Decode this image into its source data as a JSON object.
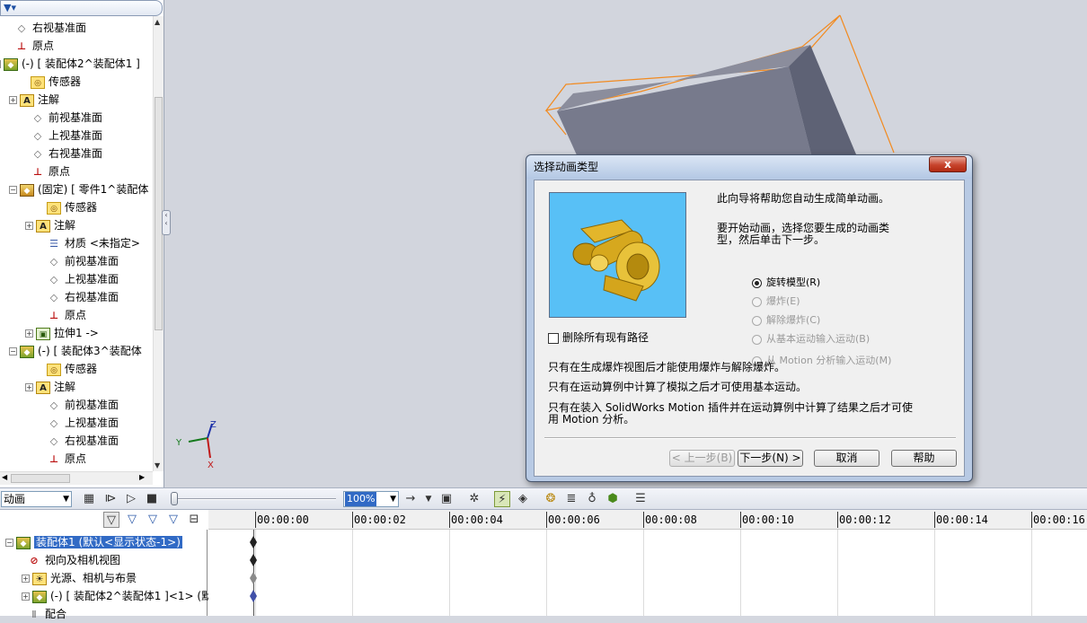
{
  "tree": {
    "filter_icon": "funnel-icon",
    "items": [
      {
        "label": "右视基准面",
        "icon": "plane-icon"
      },
      {
        "label": "原点",
        "icon": "origin-icon"
      },
      {
        "label": "(-) [ 装配体2^装配体1 ]",
        "icon": "assembly-icon"
      },
      {
        "label": "传感器",
        "icon": "sensor-icon"
      },
      {
        "label": "注解",
        "icon": "annotation-icon"
      },
      {
        "label": "前视基准面",
        "icon": "plane-icon"
      },
      {
        "label": "上视基准面",
        "icon": "plane-icon"
      },
      {
        "label": "右视基准面",
        "icon": "plane-icon"
      },
      {
        "label": "原点",
        "icon": "origin-icon"
      },
      {
        "label": "(固定) [ 零件1^装配体",
        "icon": "part-icon"
      },
      {
        "label": "传感器",
        "icon": "sensor-icon"
      },
      {
        "label": "注解",
        "icon": "annotation-icon"
      },
      {
        "label": "材质 <未指定>",
        "icon": "material-icon"
      },
      {
        "label": "前视基准面",
        "icon": "plane-icon"
      },
      {
        "label": "上视基准面",
        "icon": "plane-icon"
      },
      {
        "label": "右视基准面",
        "icon": "plane-icon"
      },
      {
        "label": "原点",
        "icon": "origin-icon"
      },
      {
        "label": "拉伸1 ->",
        "icon": "extrude-icon"
      },
      {
        "label": "(-) [ 装配体3^装配体",
        "icon": "assembly-icon"
      },
      {
        "label": "传感器",
        "icon": "sensor-icon"
      },
      {
        "label": "注解",
        "icon": "annotation-icon"
      },
      {
        "label": "前视基准面",
        "icon": "plane-icon"
      },
      {
        "label": "上视基准面",
        "icon": "plane-icon"
      },
      {
        "label": "右视基准面",
        "icon": "plane-icon"
      },
      {
        "label": "原点",
        "icon": "origin-icon"
      }
    ]
  },
  "triad": {
    "x": "X",
    "y": "Y",
    "z": "Z"
  },
  "dialog": {
    "title": "选择动画类型",
    "close_label": "x",
    "intro": "此向导将帮助您自动生成简单动画。",
    "instruction_line1": "要开始动画，选择您要生成的动画类",
    "instruction_line2": "型，然后单击下一步。",
    "options": [
      {
        "label": "旋转模型(R)",
        "checked": true,
        "enabled": true
      },
      {
        "label": "爆炸(E)",
        "checked": false,
        "enabled": false
      },
      {
        "label": "解除爆炸(C)",
        "checked": false,
        "enabled": false
      },
      {
        "label": "从基本运动输入运动(B)",
        "checked": false,
        "enabled": false
      },
      {
        "label": "从 Motion 分析输入运动(M)",
        "checked": false,
        "enabled": false
      }
    ],
    "delete_paths_label": "删除所有现有路径",
    "note1": "只有在生成爆炸视图后才能使用爆炸与解除爆炸。",
    "note2": "只有在运动算例中计算了模拟之后才可使用基本运动。",
    "note3_line1": "只有在装入 SolidWorks Motion 插件并在运动算例中计算了结果之后才可使",
    "note3_line2": "用 Motion 分析。",
    "buttons": {
      "back": "< 上一步(B)",
      "next": "下一步(N) >",
      "cancel": "取消",
      "help": "帮助"
    }
  },
  "anim_toolbar": {
    "study_type": "动画",
    "zoom": "100%",
    "icons": [
      "calculate-icon",
      "play-from-start-icon",
      "play-icon",
      "stop-icon",
      "playback-mode-icon",
      "save-animation-icon",
      "animation-wizard-icon",
      "autokey-icon",
      "add-key-icon",
      "motor-icon",
      "spring-icon",
      "damper-icon",
      "contact-icon",
      "results-icon"
    ]
  },
  "filter_icons": [
    "filter-animation-icon",
    "filter-driving-icon",
    "filter-selected-icon",
    "filter-results-icon",
    "collapse-icon"
  ],
  "timeline": {
    "ticks": [
      "00:00:00",
      "00:00:02",
      "00:00:04",
      "00:00:06",
      "00:00:08",
      "00:00:10",
      "00:00:12",
      "00:00:14",
      "00:00:16"
    ],
    "rows": [
      {
        "label": "装配体1 (默认<显示状态-1>)",
        "icon": "assembly-icon",
        "selected": true
      },
      {
        "label": "视向及相机视图",
        "icon": "camera-view-icon",
        "selected": false
      },
      {
        "label": "光源、相机与布景",
        "icon": "lights-icon",
        "selected": false
      },
      {
        "label": "(-) [ 装配体2^装配体1 ]<1> (默",
        "icon": "assembly-icon",
        "selected": false
      },
      {
        "label": "配合",
        "icon": "mates-icon",
        "selected": false
      }
    ]
  }
}
